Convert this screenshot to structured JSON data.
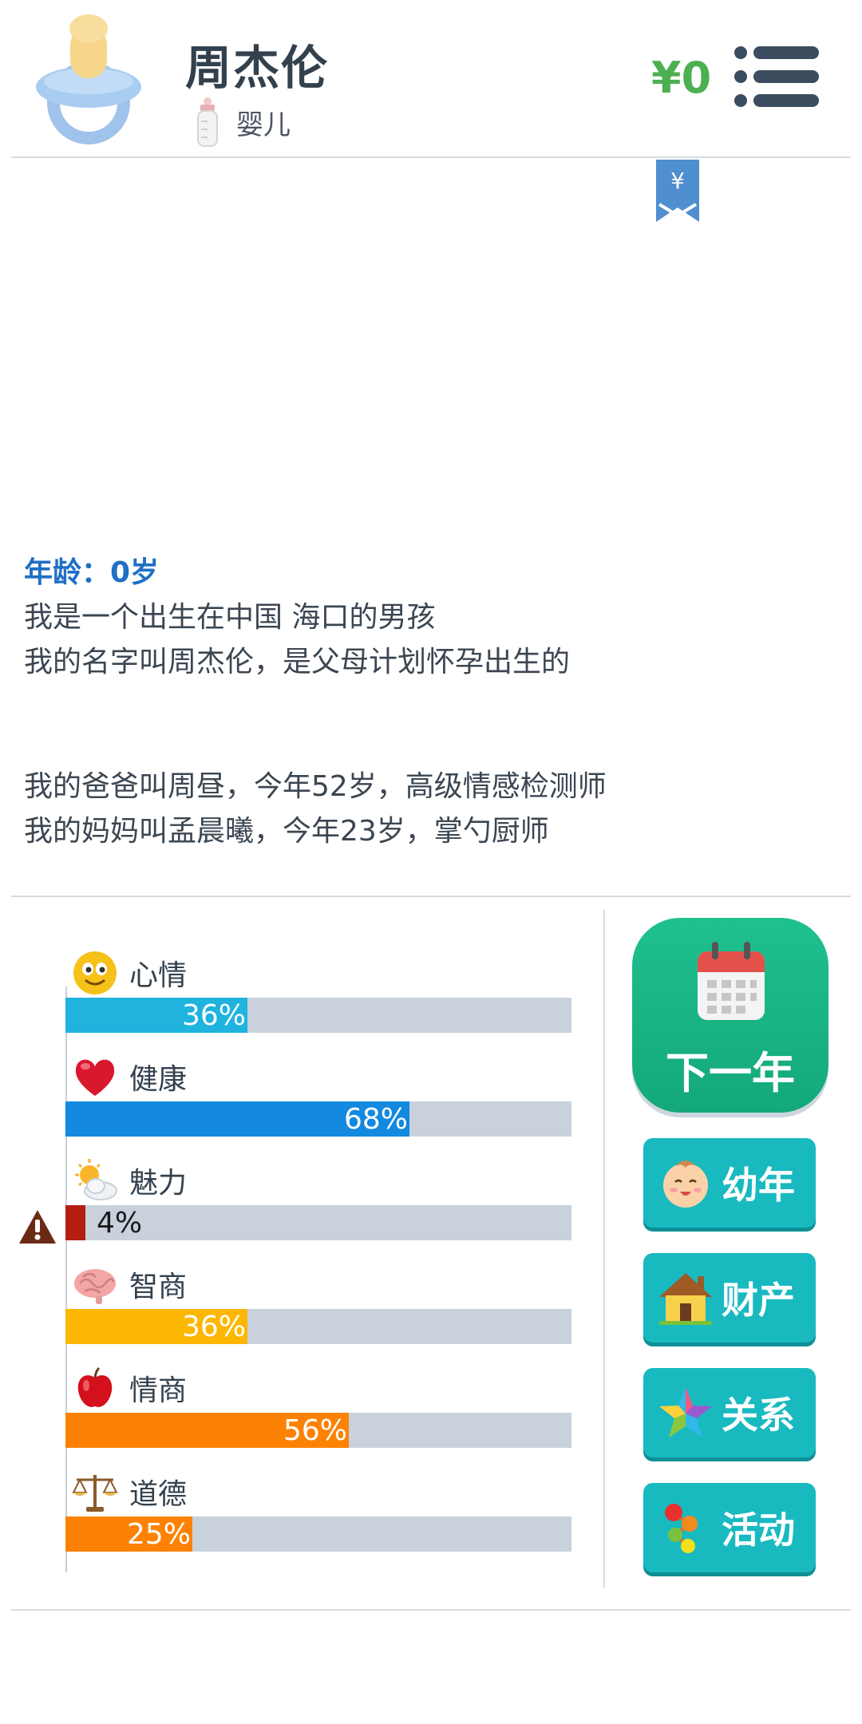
{
  "header": {
    "name": "周杰伦",
    "stage_label": "婴儿",
    "money": "¥0",
    "avatar_icon": "pacifier-icon",
    "stage_icon": "baby-bottle-icon",
    "menu_icon": "menu-list-icon"
  },
  "ribbon": {
    "label": "¥",
    "icon": "bookmark-ribbon-icon"
  },
  "story": {
    "age": "年龄：0岁",
    "lines": [
      "我是一个出生在中国 海口的男孩",
      "我的名字叫周杰伦，是父母计划怀孕出生的",
      "我的爸爸叫周昼，今年52岁，高级情感检测师",
      "我的妈妈叫孟晨曦，今年23岁，掌勺厨师"
    ]
  },
  "stats": [
    {
      "label": "心情",
      "value": 36,
      "pct": "36%",
      "color": "#1fb3de",
      "icon": "smiley-face-icon"
    },
    {
      "label": "健康",
      "value": 68,
      "pct": "68%",
      "color": "#1389e0",
      "icon": "heart-icon"
    },
    {
      "label": "魅力",
      "value": 4,
      "pct": "4%",
      "color": "#b31e12",
      "icon": "sun-behind-cloud-icon",
      "warning": true
    },
    {
      "label": "智商",
      "value": 36,
      "pct": "36%",
      "color": "#fdb702",
      "icon": "brain-icon"
    },
    {
      "label": "情商",
      "value": 56,
      "pct": "56%",
      "color": "#fd8204",
      "icon": "apple-icon"
    },
    {
      "label": "道德",
      "value": 25,
      "pct": "25%",
      "color": "#fd8204",
      "icon": "balance-scale-icon"
    }
  ],
  "actions": {
    "next_year": {
      "label": "下一年",
      "icon": "calendar-icon"
    },
    "buttons": [
      {
        "label": "幼年",
        "icon": "baby-face-icon"
      },
      {
        "label": "财产",
        "icon": "house-icon"
      },
      {
        "label": "关系",
        "icon": "star-icon"
      },
      {
        "label": "活动",
        "icon": "colored-dots-icon"
      }
    ]
  },
  "warning_icon": "warning-triangle-icon",
  "colors": {
    "accent_green": "#1fc08f",
    "button_teal": "#19b9c0",
    "money_green": "#4caf50",
    "age_blue": "#1f6fc4"
  }
}
